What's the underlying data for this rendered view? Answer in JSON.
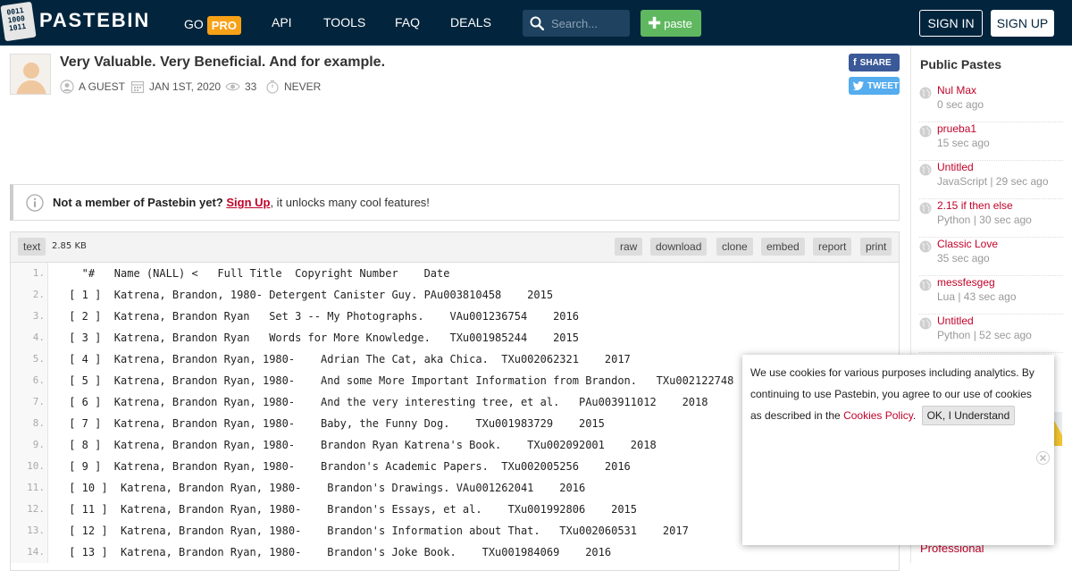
{
  "header": {
    "logo_text": "PASTEBIN",
    "logo_digits": [
      "0011",
      "1000",
      "1011"
    ],
    "nav": [
      {
        "label": "GO",
        "badge": "PRO"
      },
      {
        "label": "API"
      },
      {
        "label": "TOOLS"
      },
      {
        "label": "FAQ"
      },
      {
        "label": "DEALS"
      }
    ],
    "search_placeholder": "Search...",
    "paste_label": "paste",
    "signin_label": "SIGN IN",
    "signup_label": "SIGN UP"
  },
  "paste": {
    "title": "Very Valuable. Very Beneficial. And for example.",
    "author": "A GUEST",
    "date": "JAN 1ST, 2020",
    "views": "33",
    "expiry": "NEVER",
    "share_label": "SHARE",
    "tweet_label": "TWEET"
  },
  "notice": {
    "lead": "Not a member of Pastebin yet?",
    "link": "Sign Up",
    "tail": ", it unlocks many cool features!"
  },
  "code": {
    "syntax": "text",
    "size": "2.85 KB",
    "actions": [
      "raw",
      "download",
      "clone",
      "embed",
      "report",
      "print"
    ],
    "lines": [
      {
        "n": "1.",
        "t": "   \"#   Name (NALL) <   Full Title  Copyright Number    Date"
      },
      {
        "n": "2.",
        "t": " [ 1 ]  Katrena, Brandon, 1980- Detergent Canister Guy. PAu003810458    2015"
      },
      {
        "n": "3.",
        "t": " [ 2 ]  Katrena, Brandon Ryan   Set 3 -- My Photographs.    VAu001236754    2016"
      },
      {
        "n": "4.",
        "t": " [ 3 ]  Katrena, Brandon Ryan   Words for More Knowledge.   TXu001985244    2015"
      },
      {
        "n": "5.",
        "t": " [ 4 ]  Katrena, Brandon Ryan, 1980-    Adrian The Cat, aka Chica.  TXu002062321    2017"
      },
      {
        "n": "6.",
        "t": " [ 5 ]  Katrena, Brandon Ryan, 1980-    And some More Important Information from Brandon.   TXu002122748    2018"
      },
      {
        "n": "7.",
        "t": " [ 6 ]  Katrena, Brandon Ryan, 1980-    And the very interesting tree, et al.   PAu003911012    2018"
      },
      {
        "n": "8.",
        "t": " [ 7 ]  Katrena, Brandon Ryan, 1980-    Baby, the Funny Dog.    TXu001983729    2015"
      },
      {
        "n": "9.",
        "t": " [ 8 ]  Katrena, Brandon Ryan, 1980-    Brandon Ryan Katrena's Book.    TXu002092001    2018"
      },
      {
        "n": "10.",
        "t": " [ 9 ]  Katrena, Brandon Ryan, 1980-    Brandon's Academic Papers.  TXu002005256    2016"
      },
      {
        "n": "11.",
        "t": " [ 10 ]  Katrena, Brandon Ryan, 1980-    Brandon's Drawings. VAu001262041    2016"
      },
      {
        "n": "12.",
        "t": " [ 11 ]  Katrena, Brandon Ryan, 1980-    Brandon's Essays, et al.    TXu001992806    2015"
      },
      {
        "n": "13.",
        "t": " [ 12 ]  Katrena, Brandon Ryan, 1980-    Brandon's Information about That.   TXu002060531    2017"
      },
      {
        "n": "14.",
        "t": " [ 13 ]  Katrena, Brandon Ryan, 1980-    Brandon's Joke Book.    TXu001984069    2016"
      }
    ]
  },
  "sidebar": {
    "title": "Public Pastes",
    "items": [
      {
        "name": "Nul Max",
        "meta": "0 sec ago"
      },
      {
        "name": "prueba1",
        "meta": "15 sec ago"
      },
      {
        "name": "Untitled",
        "meta": "JavaScript | 29 sec ago"
      },
      {
        "name": "2.15 if then else",
        "meta": "Python | 30 sec ago"
      },
      {
        "name": "Classic Love",
        "meta": "35 sec ago"
      },
      {
        "name": "messfesgeg",
        "meta": "Lua | 43 sec ago"
      },
      {
        "name": "Untitled",
        "meta": "Python | 52 sec ago"
      }
    ],
    "bottom_link": "Professional"
  },
  "cookie": {
    "text": "We use cookies for various purposes including analytics. By continuing to use Pastebin, you agree to our use of cookies as described in the ",
    "link": "Cookies Policy",
    "after_link": ".",
    "button": "OK, I Understand"
  },
  "colors": {
    "header_bg": "#02253d",
    "accent_red": "#c0032a",
    "pro_orange": "#f7a117",
    "paste_green": "#5fb85f",
    "facebook": "#3b5998",
    "twitter": "#55acee"
  }
}
